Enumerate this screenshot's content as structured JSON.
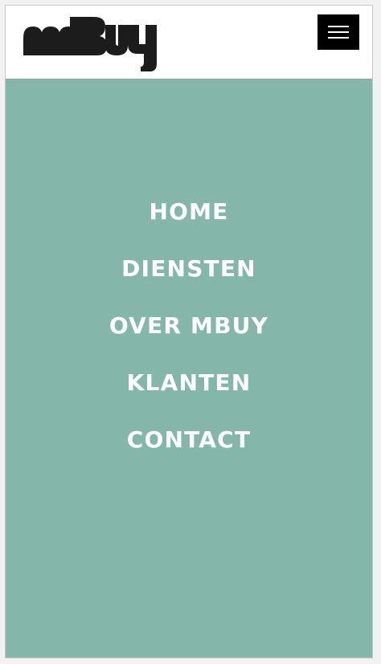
{
  "header": {
    "logo_text": "mBuy",
    "menu_button_icon": "hamburger-icon"
  },
  "nav": {
    "items": [
      {
        "label": "HOME"
      },
      {
        "label": "DIENSTEN"
      },
      {
        "label": "OVER MBUY"
      },
      {
        "label": "KLANTEN"
      },
      {
        "label": "CONTACT"
      }
    ]
  },
  "colors": {
    "overlay": "#84b7aa",
    "logo": "#1c1c1c",
    "menu_button": "#000000",
    "nav_text": "#ffffff"
  }
}
